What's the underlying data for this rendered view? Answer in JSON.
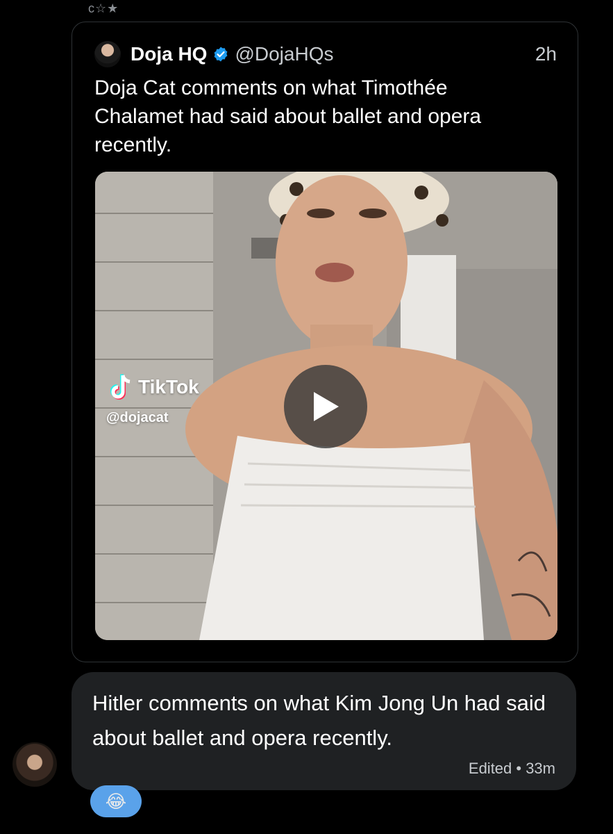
{
  "top_fragment": "c☆★",
  "quoted_post": {
    "author_name": "Doja HQ",
    "handle": "@DojaHQs",
    "time": "2h",
    "text": "Doja Cat comments on what Timothée Chalamet had said about ballet and opera recently.",
    "media": {
      "tiktok_brand": "TikTok",
      "tiktok_handle": "@dojacat"
    }
  },
  "reply": {
    "text": "Hitler comments on what Kim Jong Un had said about ballet and opera recently.",
    "meta": "Edited • 33m"
  },
  "reaction": {
    "emoji": "😂"
  },
  "colors": {
    "background": "#000000",
    "bubble": "#1f2123",
    "verified": "#1d9bf0",
    "reaction_pill": "#5aa2ea"
  }
}
